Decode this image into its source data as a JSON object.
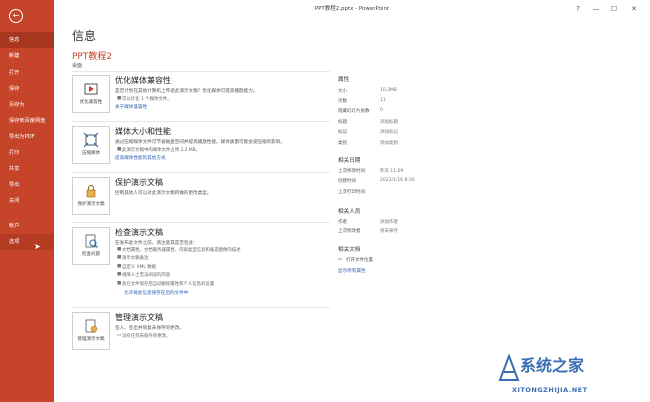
{
  "window": {
    "title": "PPT教程2.pptx - PowerPoint",
    "controls": [
      "?",
      "—",
      "☐",
      "✕"
    ]
  },
  "sidebar": {
    "back_icon": "back-arrow-icon",
    "items": [
      {
        "label": "信息",
        "active": true
      },
      {
        "label": "新建"
      },
      {
        "label": "打开"
      },
      {
        "label": "保存"
      },
      {
        "label": "另存为"
      },
      {
        "label": "保存到百度网盘"
      },
      {
        "label": "导出为PDF"
      },
      {
        "label": "打印"
      },
      {
        "label": "共享"
      },
      {
        "label": "导出"
      },
      {
        "label": "关闭"
      },
      {
        "label": "帐户"
      },
      {
        "label": "选项"
      }
    ]
  },
  "main": {
    "page_title": "信息",
    "file_title": "PPT教程2",
    "file_path": "桌面",
    "sections": [
      {
        "button_label": "优化兼容性",
        "title": "优化媒体兼容性",
        "desc": "是否计划在其他计算机上传递此演示文稿？优化媒体可提高播放能力。",
        "sub": "可以优化 1 个媒体文件。",
        "link": "关于媒体兼容性"
      },
      {
        "button_label": "压缩媒体",
        "title": "媒体大小和性能",
        "desc": "通过压缩媒体文件可节省磁盘空间并提高播放性能。媒体质量可能会受压缩的影响。",
        "sub": "此演示文稿中的媒体文件占用 2.2 MB。",
        "link": "提高媒体性能的其他方式"
      },
      {
        "button_label": "保护演示文稿",
        "title": "保护演示文稿",
        "desc": "控制其他人可以对此演示文稿所做的更改类型。"
      },
      {
        "button_label": "检查问题",
        "title": "检查演示文稿",
        "desc": "在发布此文件之前，请注意其是否包含：",
        "bullets": [
          "文档属性、文档服务器属性、内容类型信息和备选图像的描述",
          "演示文稿备注",
          "自定义 XML 数据",
          "视障人士无法阅读的内容",
          "会在文件保存后自动删除属性和个人信息的设置"
        ],
        "link": "允许将此信息保存在您的文件中"
      },
      {
        "button_label": "管理演示文稿",
        "title": "管理演示文稿",
        "desc": "签入、签出并恢复未保存的更改。",
        "sub": "没有任何未保存的更改。"
      }
    ]
  },
  "properties": {
    "header": "属性",
    "rows": [
      {
        "k": "大小",
        "v": "10.3MB"
      },
      {
        "k": "页数",
        "v": "11"
      },
      {
        "k": "隐藏幻灯片张数",
        "v": "0"
      },
      {
        "k": "标题",
        "v": "添加标题"
      },
      {
        "k": "标记",
        "v": "添加标记"
      },
      {
        "k": "类别",
        "v": "添加类别"
      }
    ],
    "dates_header": "相关日期",
    "dates": [
      {
        "k": "上次修改时间",
        "v": "昨天 11:09"
      },
      {
        "k": "创建时间",
        "v": "2023/1/16 8:30"
      },
      {
        "k": "上次打印时间",
        "v": ""
      }
    ],
    "people_header": "相关人员",
    "people": [
      {
        "k": "作者",
        "v": "添加作者"
      },
      {
        "k": "上次修改者",
        "v": "尚未保存"
      }
    ],
    "docs_header": "相关文档",
    "docs": [
      {
        "k": "打开文件位置",
        "v": ""
      }
    ],
    "show_all": "显示所有属性"
  },
  "watermark": {
    "title": "系统之家",
    "url": "XITONGZHIJIA.NET"
  },
  "colors": {
    "accent": "#c6452a",
    "link": "#2b63b5"
  }
}
